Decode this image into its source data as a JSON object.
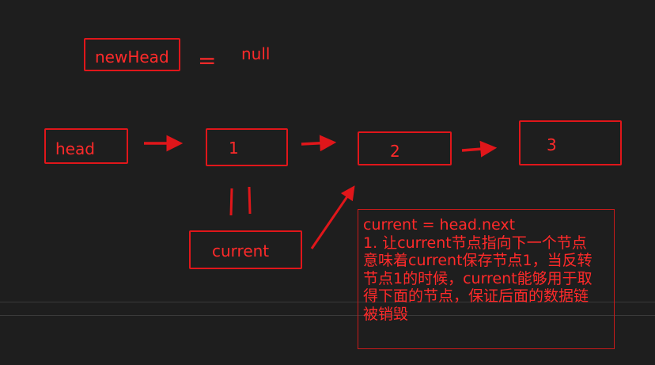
{
  "labels": {
    "new_head": "newHead",
    "equals": "=",
    "null_value": "null",
    "head": "head",
    "node_1": "1",
    "node_2": "2",
    "node_3": "3",
    "current": "current",
    "equality_marks": "||"
  },
  "note": {
    "lines": [
      "current = head.next",
      "1. 让current节点指向下一个节点",
      "意味着current保存节点1，当反转",
      "节点1的时候，current能够用于取",
      "得下面的节点，保证后面的数据链",
      "被销毁"
    ]
  },
  "colors": {
    "background": "#1e1e1e",
    "stroke": "#e0161a",
    "text": "#ff2a2a"
  }
}
